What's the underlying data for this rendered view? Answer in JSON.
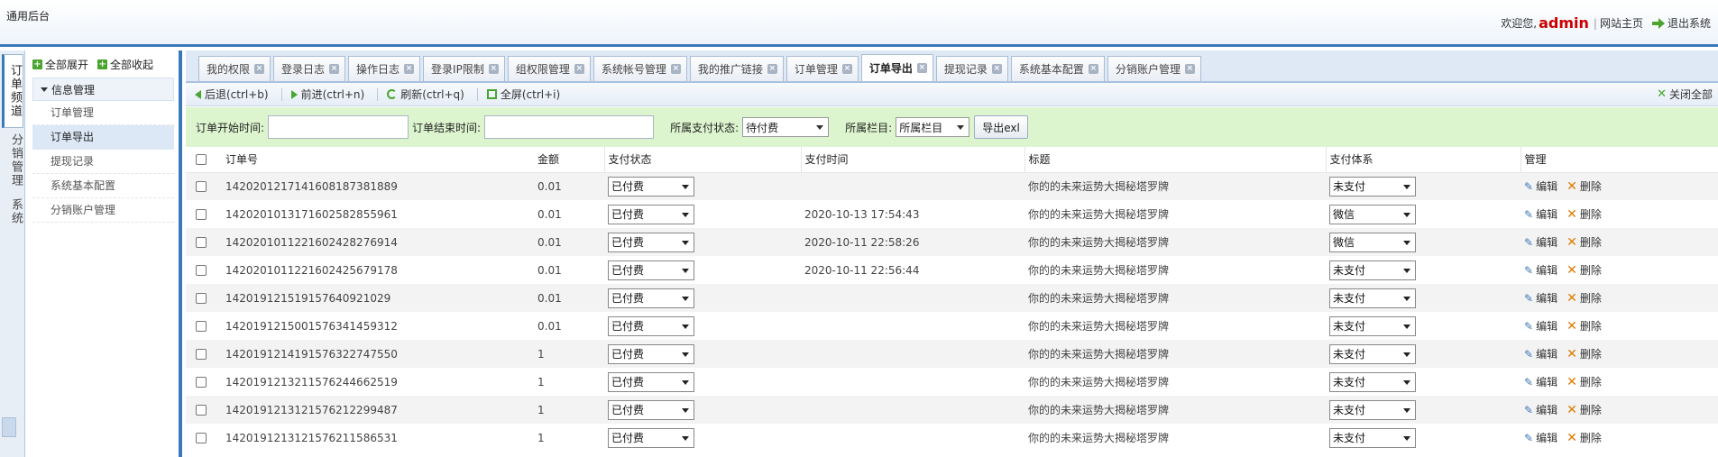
{
  "header": {
    "app_title": "通用后台",
    "welcome": "欢迎您,",
    "username": "admin",
    "separator": "|",
    "site_home": "网站主页",
    "logout": "退出系统"
  },
  "channels": [
    "订单频道",
    "分销管理",
    "系统"
  ],
  "left_menu": {
    "expand_all": "全部展开",
    "collapse_all": "全部收起",
    "group_label": "信息管理",
    "items": [
      "订单管理",
      "订单导出",
      "提现记录",
      "系统基本配置",
      "分销账户管理"
    ],
    "active_item": "订单导出"
  },
  "tabs": [
    {
      "label": "我的权限",
      "active": false
    },
    {
      "label": "登录日志",
      "active": false
    },
    {
      "label": "操作日志",
      "active": false
    },
    {
      "label": "登录IP限制",
      "active": false
    },
    {
      "label": "组权限管理",
      "active": false
    },
    {
      "label": "系统帐号管理",
      "active": false
    },
    {
      "label": "我的推广链接",
      "active": false
    },
    {
      "label": "订单管理",
      "active": false
    },
    {
      "label": "订单导出",
      "active": true
    },
    {
      "label": "提现记录",
      "active": false
    },
    {
      "label": "系统基本配置",
      "active": false
    },
    {
      "label": "分销账户管理",
      "active": false
    }
  ],
  "toolbar": {
    "back": "后退(ctrl+b)",
    "forward": "前进(ctrl+n)",
    "refresh": "刷新(ctrl+q)",
    "fullscreen": "全屏(ctrl+i)",
    "close_all": "关闭全部"
  },
  "filters": {
    "start_label": "订单开始时间:",
    "start_value": "",
    "end_label": "订单结束时间:",
    "end_value": "",
    "pay_status_label": "所属支付状态:",
    "pay_status_value": "待付费",
    "column_label": "所属栏目:",
    "column_value": "所属栏目",
    "export_button": "导出exl"
  },
  "table": {
    "headers": {
      "order_no": "订单号",
      "amount": "金额",
      "pay_status": "支付状态",
      "pay_time": "支付时间",
      "title": "标题",
      "pay_system": "支付体系",
      "manage": "管理"
    },
    "edit_label": "编辑",
    "delete_label": "删除",
    "rows": [
      {
        "order_no": "142020121714160818738188​9",
        "amount": "0.01",
        "pay_status": "已付费",
        "pay_time": "",
        "title": "你的的未来运势大揭秘塔罗牌",
        "pay_system": "未支付"
      },
      {
        "order_no": "1420201013171602582855961",
        "amount": "0.01",
        "pay_status": "已付费",
        "pay_time": "2020-10-13 17:54:43",
        "title": "你的的未来运势大揭秘塔罗牌",
        "pay_system": "微信"
      },
      {
        "order_no": "1420201011221602428276914",
        "amount": "0.01",
        "pay_status": "已付费",
        "pay_time": "2020-10-11 22:58:26",
        "title": "你的的未来运势大揭秘塔罗牌",
        "pay_system": "微信"
      },
      {
        "order_no": "1420201011221602425679178",
        "amount": "0.01",
        "pay_status": "已付费",
        "pay_time": "2020-10-11 22:56:44",
        "title": "你的的未来运势大揭秘塔罗牌",
        "pay_system": "未支付"
      },
      {
        "order_no": "1420191215191576409210​29",
        "amount": "0.01",
        "pay_status": "已付费",
        "pay_time": "",
        "title": "你的的未来运势大揭秘塔罗牌",
        "pay_system": "未支付"
      },
      {
        "order_no": "1420191215001576341459312",
        "amount": "0.01",
        "pay_status": "已付费",
        "pay_time": "",
        "title": "你的的未来运势大揭秘塔罗牌",
        "pay_system": "未支付"
      },
      {
        "order_no": "1420191214191576322747550",
        "amount": "1",
        "pay_status": "已付费",
        "pay_time": "",
        "title": "你的的未来运势大揭秘塔罗牌",
        "pay_system": "未支付"
      },
      {
        "order_no": "1420191213211576244662519",
        "amount": "1",
        "pay_status": "已付费",
        "pay_time": "",
        "title": "你的的未来运势大揭秘塔罗牌",
        "pay_system": "未支付"
      },
      {
        "order_no": "1420191213121576212299487",
        "amount": "1",
        "pay_status": "已付费",
        "pay_time": "",
        "title": "你的的未来运势大揭秘塔罗牌",
        "pay_system": "未支付"
      },
      {
        "order_no": "1420191213121576211586531",
        "amount": "1",
        "pay_status": "已付费",
        "pay_time": "",
        "title": "你的的未来运势大揭秘塔罗牌",
        "pay_system": "未支付"
      }
    ]
  }
}
